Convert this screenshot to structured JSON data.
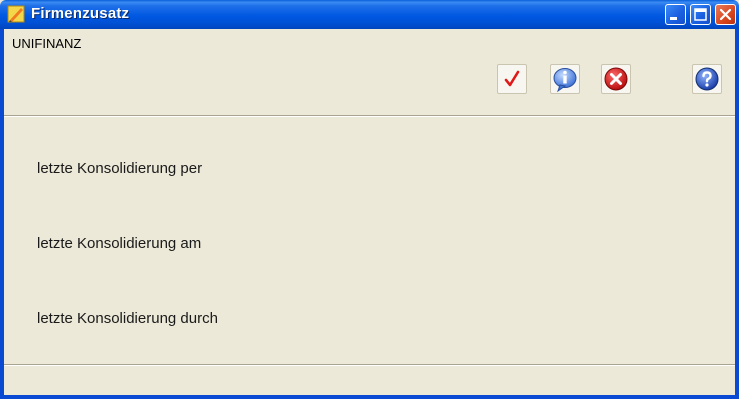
{
  "window": {
    "title": "Firmenzusatz",
    "icon": "app-pencil-icon",
    "controls": [
      "minimize-icon",
      "maximize-icon",
      "close-icon"
    ]
  },
  "toolbar": {
    "company": "UNIFINANZ",
    "buttons": [
      {
        "name": "confirm-button",
        "icon": "checkmark-icon"
      },
      {
        "name": "info-button",
        "icon": "info-icon"
      },
      {
        "name": "cancel-button",
        "icon": "cancel-icon"
      },
      {
        "name": "help-button",
        "icon": "help-icon"
      }
    ]
  },
  "fields": [
    {
      "label": "letzte Konsolidierung per"
    },
    {
      "label": "letzte Konsolidierung am"
    },
    {
      "label": "letzte Konsolidierung durch"
    }
  ],
  "colors": {
    "titlebar": "#0058e2",
    "background": "#ece9d8",
    "close_button": "#d8471f"
  }
}
